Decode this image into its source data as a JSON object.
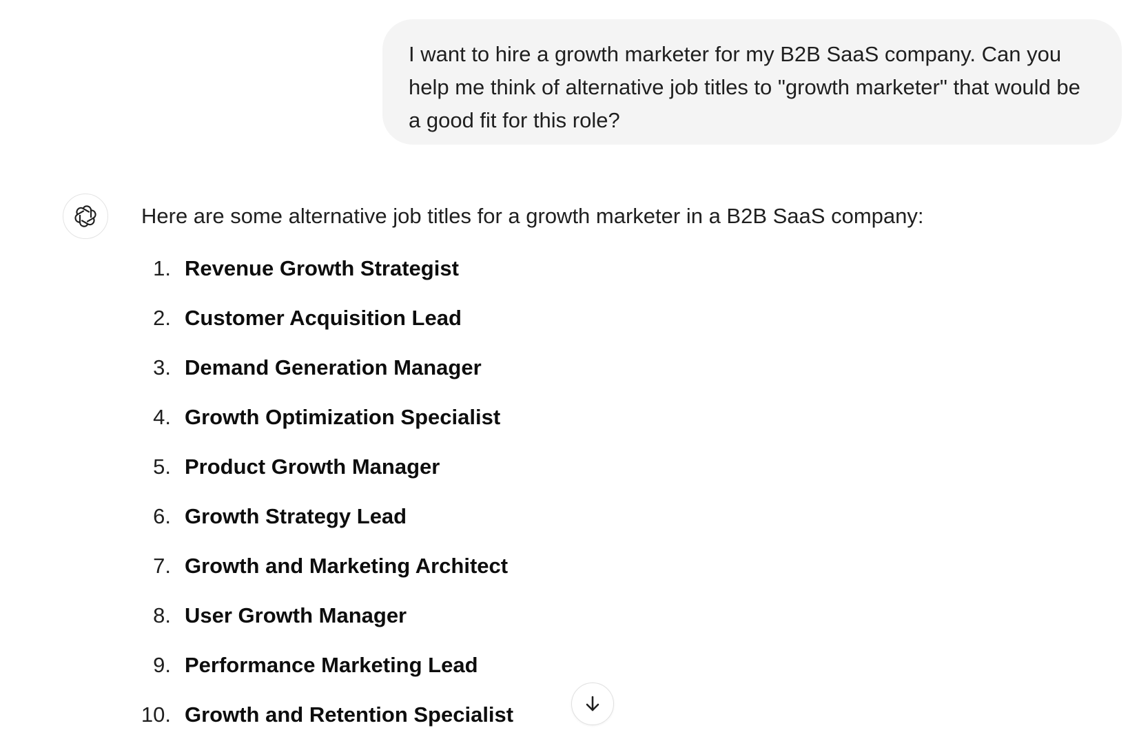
{
  "conversation": {
    "user_message": "I want to hire a growth marketer for my B2B SaaS company. Can you help me think of alternative job titles to \"growth marketer\" that would be a good fit for this role?",
    "assistant": {
      "avatar_icon": "openai-logo-icon",
      "intro": "Here are some alternative job titles for a growth marketer in a B2B SaaS company:",
      "items": [
        {
          "number": "1.",
          "title": "Revenue Growth Strategist"
        },
        {
          "number": "2.",
          "title": "Customer Acquisition Lead"
        },
        {
          "number": "3.",
          "title": "Demand Generation Manager"
        },
        {
          "number": "4.",
          "title": "Growth Optimization Specialist"
        },
        {
          "number": "5.",
          "title": "Product Growth Manager"
        },
        {
          "number": "6.",
          "title": "Growth Strategy Lead"
        },
        {
          "number": "7.",
          "title": "Growth and Marketing Architect"
        },
        {
          "number": "8.",
          "title": "User Growth Manager"
        },
        {
          "number": "9.",
          "title": "Performance Marketing Lead"
        },
        {
          "number": "10.",
          "title": "Growth and Retention Specialist"
        }
      ]
    }
  },
  "controls": {
    "scroll_down_icon": "arrow-down-icon"
  },
  "colors": {
    "user_bubble_bg": "#f4f4f4",
    "text_primary": "#0d0d0d",
    "border_light": "#e3e3e3"
  }
}
